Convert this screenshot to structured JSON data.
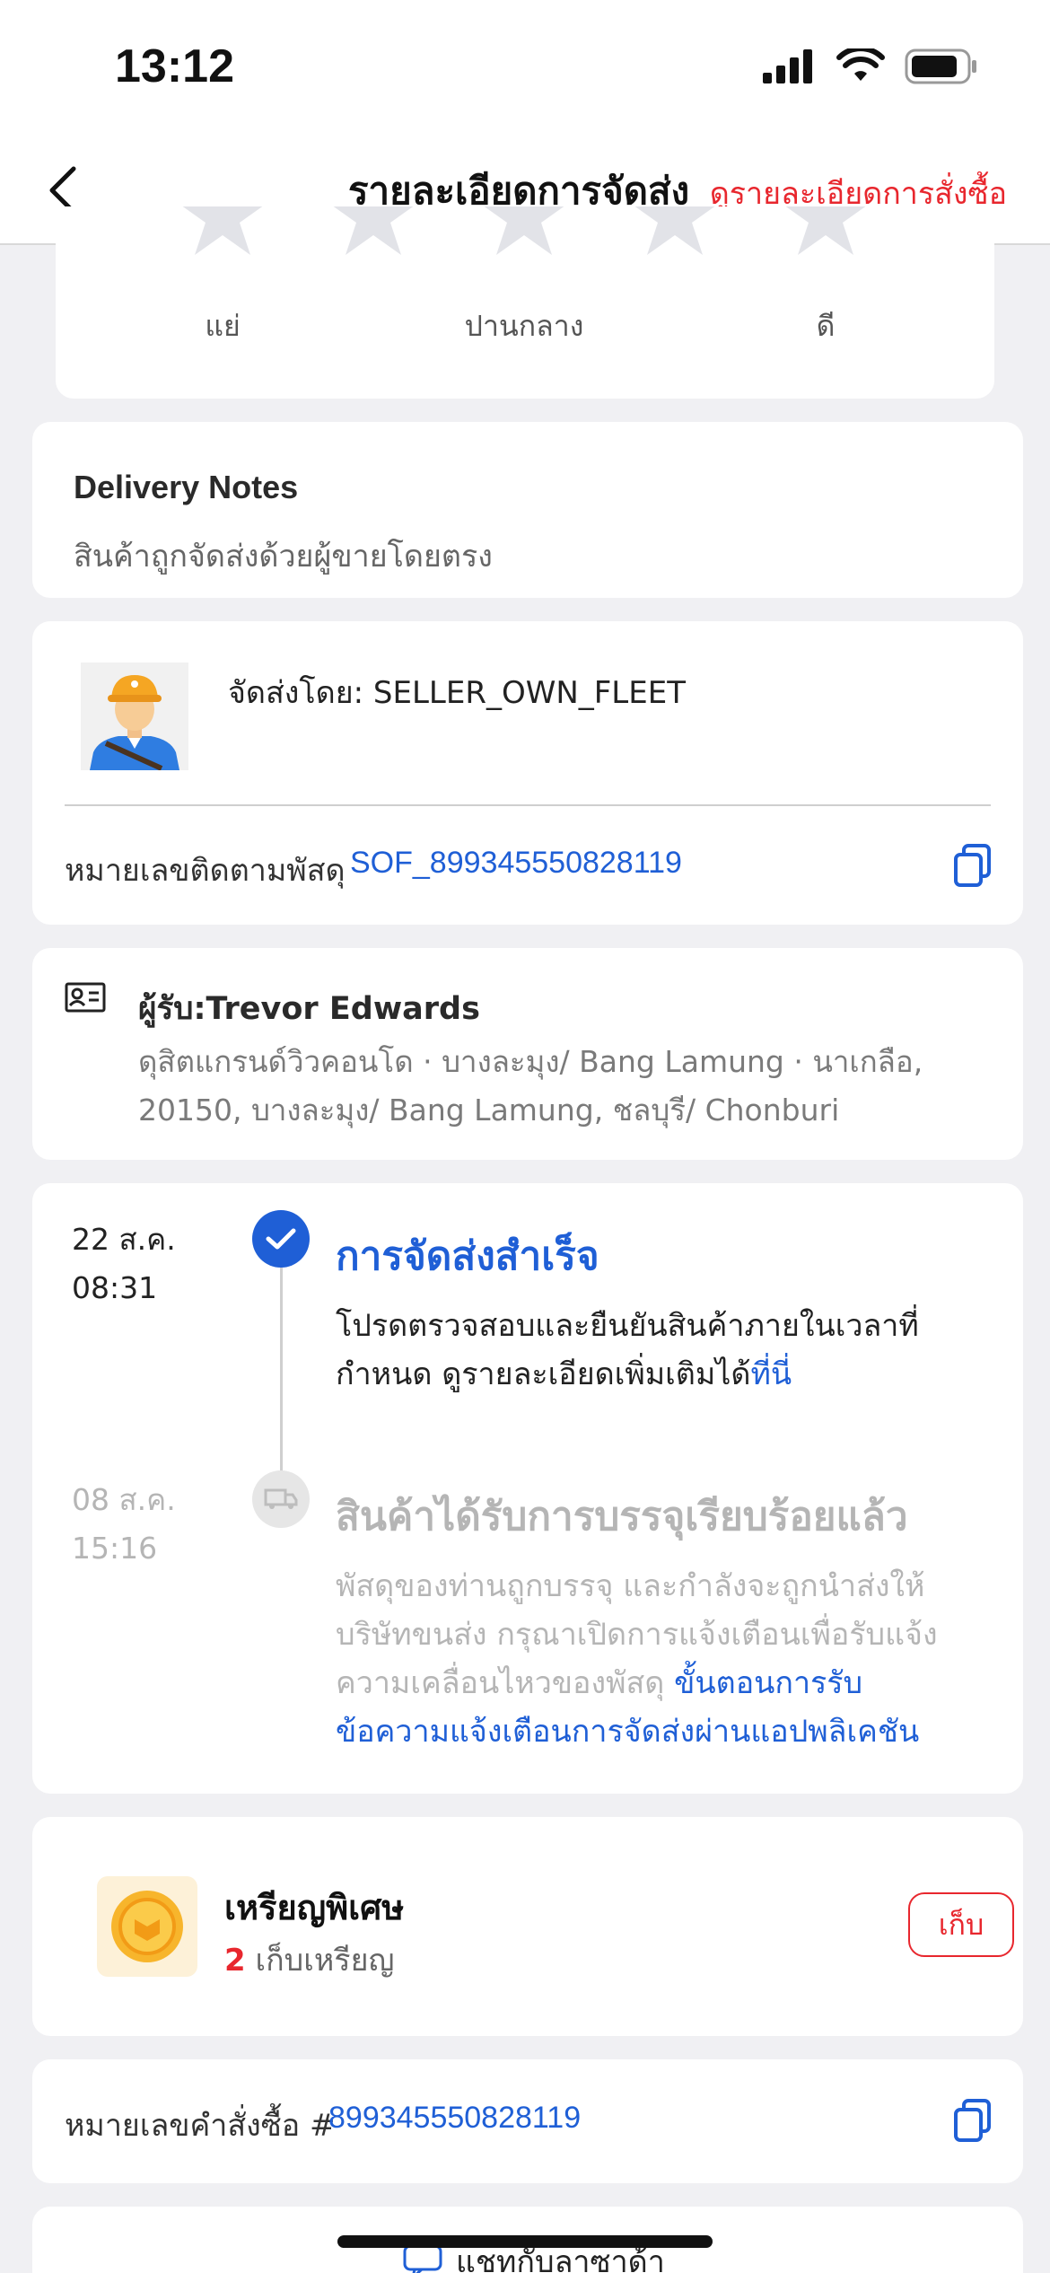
{
  "status_bar": {
    "time": "13:12"
  },
  "nav": {
    "title": "รายละเอียดการจัดส่ง",
    "order_detail_link": "ดูรายละเอียดการสั่งซื้อ"
  },
  "rating": {
    "labels": [
      "แย่",
      "ปานกลาง",
      "ดี"
    ]
  },
  "delivery_notes": {
    "title": "Delivery Notes",
    "body": "สินค้าถูกจัดส่งด้วยผู้ขายโดยตรง"
  },
  "shipping": {
    "shipped_by": "จัดส่งโดย: SELLER_OWN_FLEET",
    "tracking_label": "หมายเลขติดตามพัสดุ",
    "tracking_number": "SOF_899345550828119"
  },
  "recipient": {
    "name": "ผู้รับ:Trevor Edwards",
    "address": "ดุสิตแกรนด์วิวคอนโด · บางละมุง/ Bang Lamung · นาเกลือ, 20150, บางละมุง/ Bang Lamung, ชลบุรี/ Chonburi"
  },
  "timeline": [
    {
      "date": "22 ส.ค.",
      "time": "08:31",
      "title": "การจัดส่งสำเร็จ",
      "body": "โปรดตรวจสอบและยืนยันสินค้าภายในเวลาที่กำหนด ดูรายละเอียดเพิ่มเติมได้",
      "link": "ที่นี่"
    },
    {
      "date": "08 ส.ค.",
      "time": "15:16",
      "title": "สินค้าได้รับการบรรจุเรียบร้อยแล้ว",
      "body": "พัสดุของท่านถูกบรรจุ และกำลังจะถูกนำส่งให้บริษัทขนส่ง กรุณาเปิดการแจ้งเตือนเพื่อรับแจ้งความเคลื่อนไหวของพัสดุ ",
      "link": "ขั้นตอนการรับข้อความแจ้งเตือนการจัดส่งผ่านแอปพลิเคชัน"
    }
  ],
  "coins": {
    "title": "เหรียญพิเศษ",
    "count": "2",
    "count_label": " เก็บเหรียญ",
    "collect_button": "เก็บ"
  },
  "order": {
    "label": "หมายเลขคำสั่งซื้อ #",
    "number": "899345550828119"
  },
  "chat": {
    "label": "แชทกับลาซาด้า"
  },
  "colors": {
    "accent_red": "#e8272e",
    "link_blue": "#1f5fd6",
    "success_blue": "#1f5fd6",
    "inactive_gray": "#b5b5b5"
  }
}
